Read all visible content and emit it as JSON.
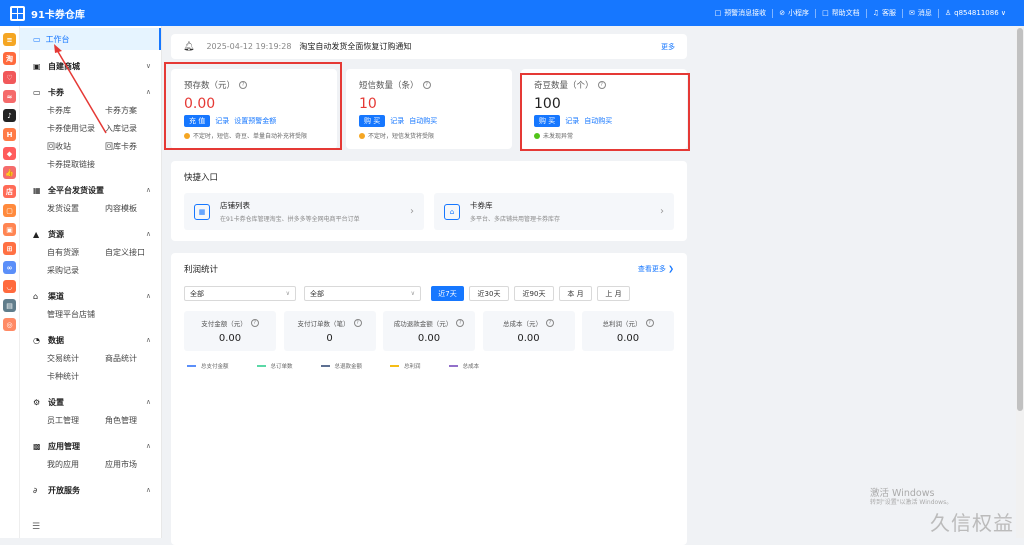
{
  "app": {
    "title": "91卡券仓库"
  },
  "topnav": [
    {
      "icon": "□",
      "name": "monitor-icon",
      "label": "预警消息接收"
    },
    {
      "icon": "⊘",
      "name": "mini-program-icon",
      "label": "小程序"
    },
    {
      "icon": "□",
      "name": "doc-icon",
      "label": "帮助文档"
    },
    {
      "icon": "♫",
      "name": "headset-icon",
      "label": "客服"
    },
    {
      "icon": "✉",
      "name": "mail-icon",
      "label": "消息"
    },
    {
      "icon": "♙",
      "name": "user-icon",
      "label": "q854811086 ∨"
    }
  ],
  "iconrail": [
    {
      "name": "brand-icon",
      "color": "#f5a623",
      "glyph": "≡"
    },
    {
      "name": "taobao-icon",
      "color": "#ff6a3d",
      "glyph": "淘"
    },
    {
      "name": "heart-icon",
      "color": "#f1585a",
      "glyph": "♡"
    },
    {
      "name": "wifi-icon",
      "color": "#f56a6a",
      "glyph": "≈"
    },
    {
      "name": "douyin-icon",
      "color": "#222222",
      "glyph": "♪"
    },
    {
      "name": "badge-icon",
      "color": "#ff7a45",
      "glyph": "H"
    },
    {
      "name": "tag-icon",
      "color": "#ff5c5c",
      "glyph": "◆"
    },
    {
      "name": "thumb-icon",
      "color": "#f56c6c",
      "glyph": "👍"
    },
    {
      "name": "shop-icon",
      "color": "#ff6b57",
      "glyph": "店"
    },
    {
      "name": "bag-icon",
      "color": "#ff8a3d",
      "glyph": "▢"
    },
    {
      "name": "gift-icon",
      "color": "#ff8552",
      "glyph": "▣"
    },
    {
      "name": "cart-icon",
      "color": "#ff7043",
      "glyph": "⊞"
    },
    {
      "name": "link-icon",
      "color": "#5b8ff9",
      "glyph": "∞"
    },
    {
      "name": "cup-icon",
      "color": "#ff6a3d",
      "glyph": "◡"
    },
    {
      "name": "card-icon",
      "color": "#607d8b",
      "glyph": "▤"
    },
    {
      "name": "circle-icon",
      "color": "#ff8a65",
      "glyph": "◎"
    }
  ],
  "sidebar": {
    "active": "工作台",
    "groups": [
      {
        "name": "self-mall",
        "icon": "▣",
        "title": "自建商城",
        "chev": "∨",
        "items": []
      },
      {
        "name": "coupon",
        "icon": "▭",
        "title": "卡券",
        "chev": "∧",
        "items": [
          "卡券库",
          "卡券方案",
          "卡券使用记录",
          "入库记录",
          "回收站",
          "回库卡券",
          "卡券提取链接"
        ]
      },
      {
        "name": "platform-ship",
        "icon": "▦",
        "title": "全平台发货设置",
        "chev": "∧",
        "items": [
          "发货设置",
          "内容模板"
        ]
      },
      {
        "name": "source",
        "icon": "▲",
        "title": "货源",
        "chev": "∧",
        "items": [
          "自有货源",
          "自定义接口",
          "采购记录"
        ]
      },
      {
        "name": "channel",
        "icon": "⌂",
        "title": "渠道",
        "chev": "∧",
        "items": [
          "管理平台店铺"
        ]
      },
      {
        "name": "data",
        "icon": "◔",
        "title": "数据",
        "chev": "∧",
        "items": [
          "交易统计",
          "商品统计",
          "卡种统计"
        ]
      },
      {
        "name": "settings",
        "icon": "⚙",
        "title": "设置",
        "chev": "∧",
        "items": [
          "员工管理",
          "角色管理"
        ]
      },
      {
        "name": "app-mgmt",
        "icon": "▩",
        "title": "应用管理",
        "chev": "∧",
        "items": [
          "我的应用",
          "应用市场"
        ]
      },
      {
        "name": "open-service",
        "icon": "∂",
        "title": "开放服务",
        "chev": "∧",
        "items": []
      }
    ]
  },
  "notice": {
    "time": "2025-04-12 19:19:28",
    "message": "淘宝自动发货全面恢复订购通知",
    "more": "更多"
  },
  "cards": [
    {
      "name": "prepaid",
      "title": "预存数（元）",
      "value": "0.00",
      "value_red": true,
      "button": "充 值",
      "links": [
        "记录",
        "设置预警金额"
      ],
      "note": "不定时，短信、奇豆、单量自动补充将受限",
      "dot_color": "#f5a623"
    },
    {
      "name": "sms",
      "title": "短信数量（条）",
      "value": "10",
      "value_red": true,
      "button": "购 买",
      "links": [
        "记录",
        "自动购买"
      ],
      "note": "不定时，短信发货将受限",
      "dot_color": "#f5a623"
    },
    {
      "name": "qidou",
      "title": "奇豆数量（个）",
      "value": "100",
      "value_red": false,
      "button": "购 买",
      "links": [
        "记录",
        "自动购买"
      ],
      "note": "未发现异常",
      "dot_color": "#52c41a"
    }
  ],
  "quick": {
    "title": "快捷入口",
    "items": [
      {
        "name": "shop-list",
        "glyph": "▦",
        "title": "店铺列表",
        "desc": "在91卡券仓库管理淘宝、拼多多等全网电商平台订单"
      },
      {
        "name": "coupon-lib",
        "glyph": "⌂",
        "title": "卡券库",
        "desc": "多平台、多店铺共用管理卡券库存"
      }
    ]
  },
  "stats": {
    "title": "利润统计",
    "more": "查看更多 ❯",
    "select1": "全部",
    "select2": "全部",
    "ranges": [
      "近7天",
      "近30天",
      "近90天",
      "本 月",
      "上 月"
    ],
    "metrics": [
      {
        "label": "支付金额（元）",
        "value": "0.00"
      },
      {
        "label": "支付订单数（笔）",
        "value": "0"
      },
      {
        "label": "成功退款金额（元）",
        "value": "0.00"
      },
      {
        "label": "总成本（元）",
        "value": "0.00"
      },
      {
        "label": "总利润（元）",
        "value": "0.00"
      }
    ],
    "legend": [
      {
        "label": "总支付金额",
        "color": "#5b8ff9"
      },
      {
        "label": "总订单数",
        "color": "#5ad8a6"
      },
      {
        "label": "总退款金额",
        "color": "#5d7092"
      },
      {
        "label": "总利润",
        "color": "#f6bd16"
      },
      {
        "label": "总成本",
        "color": "#9270ca"
      }
    ]
  },
  "watermark": {
    "line1": "激活 Windows",
    "line2": "转到\"设置\"以激活 Windows。"
  },
  "brandmark": "久信权益"
}
